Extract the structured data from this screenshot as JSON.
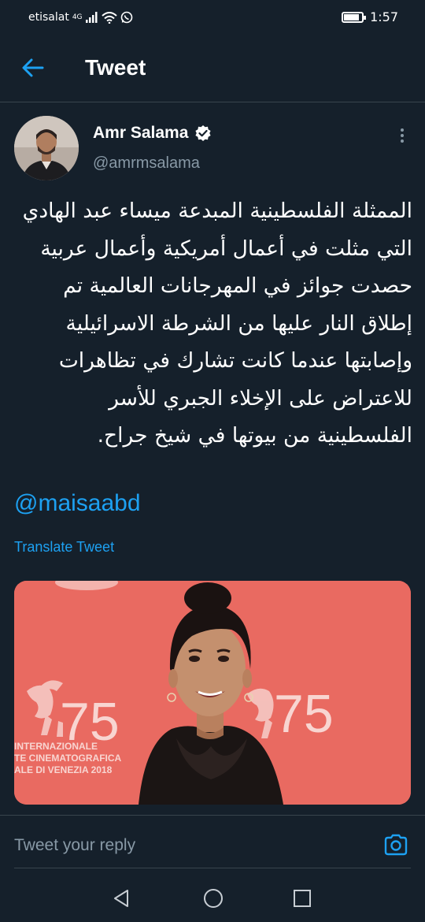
{
  "status_bar": {
    "carrier": "etisalat",
    "network": "4G",
    "time": "1:57",
    "battery_level": 0.85,
    "icons": [
      "signal-icon",
      "wifi-icon",
      "whatsapp-icon",
      "battery-icon"
    ]
  },
  "header": {
    "title": "Tweet",
    "back_icon": "arrow-left-icon"
  },
  "tweet": {
    "author_name": "Amr Salama",
    "author_handle": "@amrmsalama",
    "verified": true,
    "text": "الممثلة الفلسطينية المبدعة ميساء عبد الهادي التي مثلت في أعمال أمريكية وأعمال عربية حصدت جوائز في المهرجانات العالمية تم إطلاق النار عليها من الشرطة الاسرائيلية وإصابتها عندما كانت تشارك في تظاهرات للاعتراض على الإخلاء الجبري للأسر الفلسطينية من بيوتها في شيخ جراح.",
    "mention": "@maisaabd",
    "translate_label": "Translate Tweet",
    "photo": {
      "banner_line1": "INTERNAZIONALE",
      "banner_line2": "TE CINEMATOGRAFICA",
      "banner_line3": "ALE DI VENEZIA 2018",
      "banner_number": "75",
      "background_color": "#e96a61"
    }
  },
  "reply": {
    "placeholder": "Tweet your reply",
    "camera_icon": "camera-icon"
  },
  "nav": {
    "icons": [
      "nav-back-icon",
      "nav-home-icon",
      "nav-recent-icon"
    ]
  },
  "colors": {
    "background": "#15202b",
    "accent": "#1da1f2",
    "secondary_text": "#8899a6",
    "divider": "#38444d"
  }
}
